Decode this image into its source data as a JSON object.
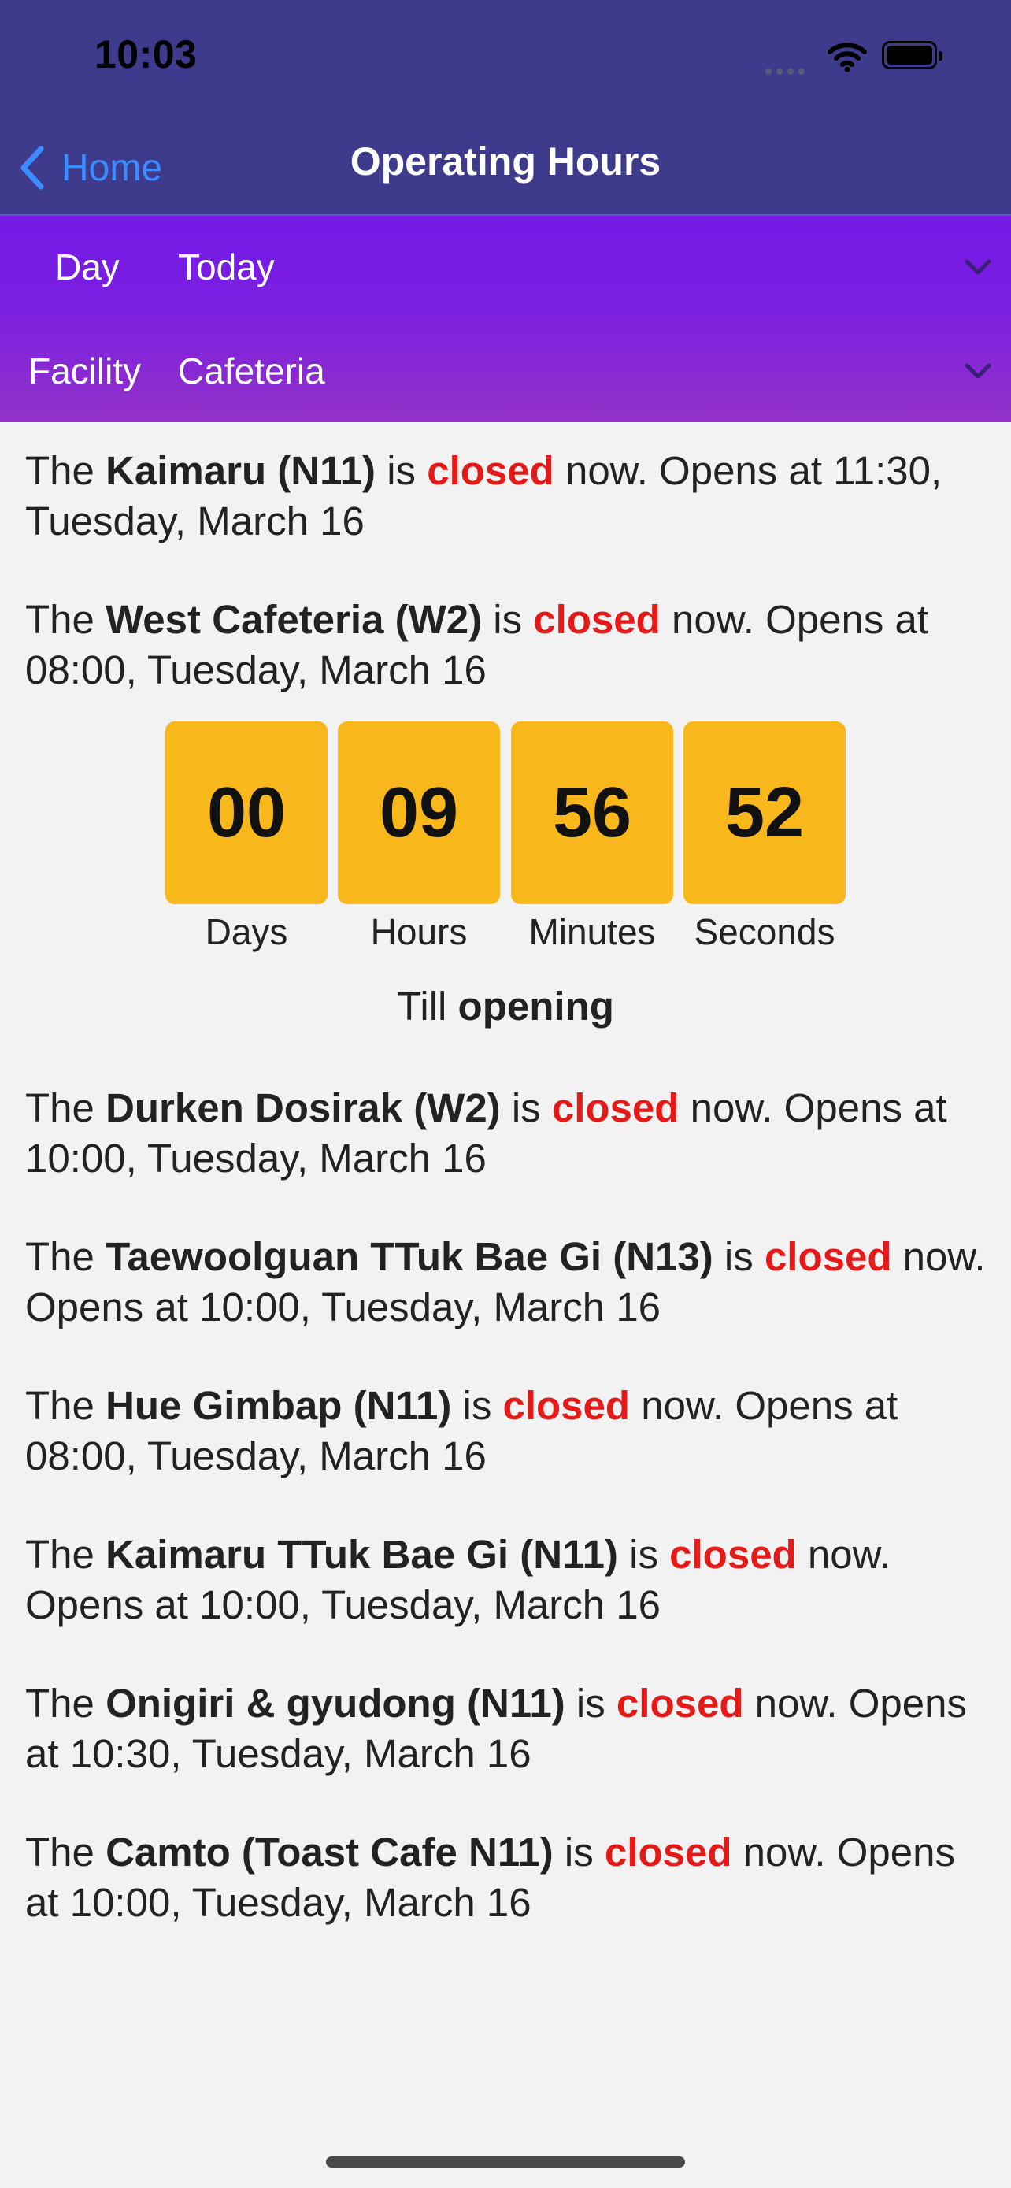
{
  "status_bar": {
    "time": "10:03"
  },
  "nav": {
    "back_label": "Home",
    "title": "Operating Hours"
  },
  "filters": {
    "day": {
      "label": "Day",
      "value": "Today"
    },
    "facility": {
      "label": "Facility",
      "value": "Cafeteria"
    }
  },
  "text": {
    "the": "The ",
    "is": " is ",
    "now": " now. Opens at "
  },
  "entries": [
    {
      "name": "Kaimaru (N11)",
      "status": "closed",
      "opens": "11:30, Tuesday, March 16"
    },
    {
      "name": "West Cafeteria (W2)",
      "status": "closed",
      "opens": "08:00, Tuesday, March 16"
    },
    {
      "name": "Durken Dosirak (W2)",
      "status": "closed",
      "opens": "10:00, Tuesday, March 16"
    },
    {
      "name": "Taewoolguan TTuk Bae Gi (N13)",
      "status": "closed",
      "opens": "10:00, Tuesday, March 16"
    },
    {
      "name": "Hue Gimbap (N11)",
      "status": "closed",
      "opens": "08:00, Tuesday, March 16"
    },
    {
      "name": "Kaimaru TTuk Bae Gi (N11)",
      "status": "closed",
      "opens": "10:00, Tuesday, March 16"
    },
    {
      "name": "Onigiri & gyudong (N11)",
      "status": "closed",
      "opens": "10:30, Tuesday, March 16"
    },
    {
      "name": "Camto (Toast Cafe N11)",
      "status": "closed",
      "opens": "10:00, Tuesday, March 16"
    }
  ],
  "countdown": {
    "days": "00",
    "hours": "09",
    "minutes": "56",
    "seconds": "52",
    "days_label": "Days",
    "hours_label": "Hours",
    "minutes_label": "Minutes",
    "seconds_label": "Seconds",
    "till_prefix": "Till ",
    "till_bold": "opening"
  },
  "colors": {
    "accent": "#f8b71a",
    "closed": "#e61919",
    "nav": "#3e3a8c",
    "back": "#3d8cff"
  }
}
